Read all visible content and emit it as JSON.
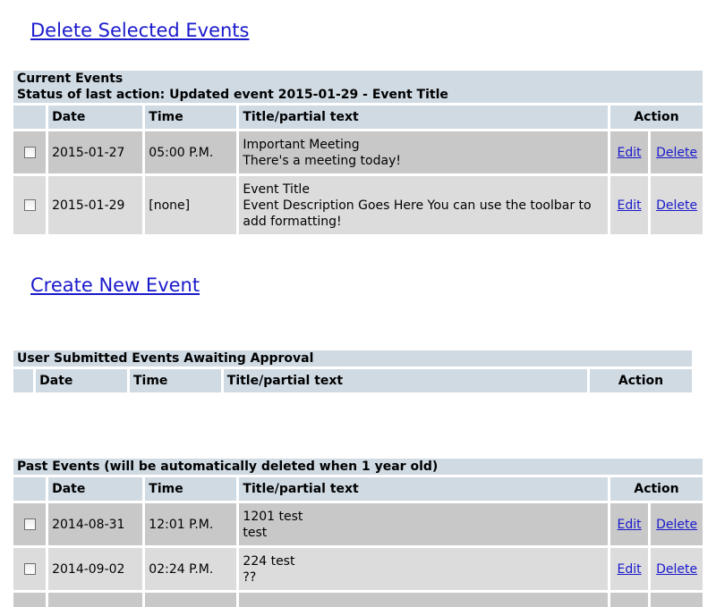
{
  "links": {
    "delete_selected": "Delete Selected Events",
    "create_new": "Create New Event"
  },
  "current": {
    "caption_title": "Current Events",
    "caption_status": "Status of last action: Updated event 2015-01-29 - Event Title",
    "headers": {
      "date": "Date",
      "time": "Time",
      "title": "Title/partial text",
      "action": "Action"
    },
    "rows": [
      {
        "date": "2015-01-27",
        "time": "05:00 P.M.",
        "title": "Important Meeting",
        "text": "There's a meeting today!",
        "edit": "Edit",
        "delete": "Delete"
      },
      {
        "date": "2015-01-29",
        "time": "[none]",
        "title": "Event Title",
        "text": "Event Description Goes Here You can use the toolbar to add formatting!",
        "edit": "Edit",
        "delete": "Delete"
      }
    ]
  },
  "submitted": {
    "caption": "User Submitted Events Awaiting Approval",
    "headers": {
      "date": "Date",
      "time": "Time",
      "title": "Title/partial text",
      "action": "Action"
    }
  },
  "past": {
    "caption": "Past Events (will be automatically deleted when 1 year old)",
    "headers": {
      "date": "Date",
      "time": "Time",
      "title": "Title/partial text",
      "action": "Action"
    },
    "rows": [
      {
        "date": "2014-08-31",
        "time": "12:01 P.M.",
        "title": "1201 test",
        "text": "test",
        "edit": "Edit",
        "delete": "Delete"
      },
      {
        "date": "2014-09-02",
        "time": "02:24 P.M.",
        "title": "224 test",
        "text": "??",
        "edit": "Edit",
        "delete": "Delete"
      }
    ]
  }
}
